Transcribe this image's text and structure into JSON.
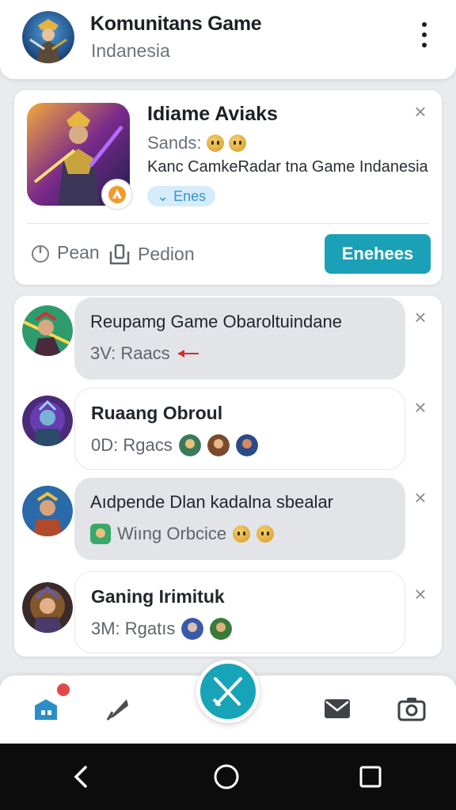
{
  "header": {
    "title": "Komunitans Game",
    "subtitle": "Indanesia",
    "avatar_icon": "hero-avatar",
    "menu_icon": "more-vertical-icon"
  },
  "featured": {
    "name": "Idiame Aviaks",
    "sands_label": "Sands:",
    "description": "Kanc CamkeRadar tna Game Indanesia",
    "pill_label": "Enes",
    "pill_icon": "chevron-down-icon",
    "action_1": "Pean",
    "action_1_icon": "power-icon",
    "action_2": "Pedion",
    "action_2_icon": "share-icon",
    "button_label": "Enehees",
    "button_color": "#1aa0b7"
  },
  "chats": [
    {
      "title": "Reupamg Game Obaroltuindane",
      "subtitle": "3V: Raacs",
      "style": "grey",
      "bold": false
    },
    {
      "title": "Ruaang Obroul",
      "subtitle": "0D: Rgacs",
      "style": "white",
      "bold": true
    },
    {
      "title": "Aıdpende Dlan kadalna sbealar",
      "subtitle": "Wiıng Orbcice",
      "style": "grey",
      "bold": false
    },
    {
      "title": "Ganing Irimituk",
      "subtitle": "3M: Rgatıs",
      "style": "white",
      "bold": true
    }
  ],
  "nav": {
    "notification_count": "",
    "items": [
      "home-icon",
      "quill-icon",
      "swords-icon",
      "mail-icon",
      "camera-icon"
    ]
  },
  "system_nav": [
    "back-icon",
    "home-circle-icon",
    "recents-icon"
  ]
}
